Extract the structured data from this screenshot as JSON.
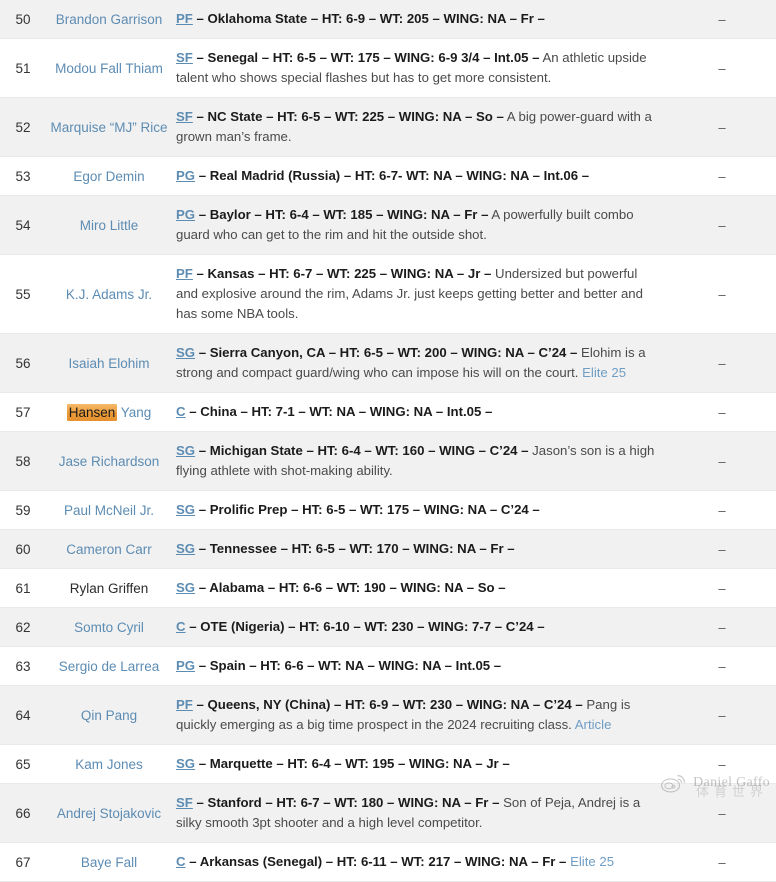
{
  "table": {
    "last_column_value": "–",
    "rows": [
      {
        "rank": "50",
        "name": "Brandon Garrison",
        "name_is_link": true,
        "highlight": "",
        "position": "PF",
        "headline": " – Oklahoma State – HT: 6-9 – WT: 205 – WING: NA – Fr –",
        "note": "",
        "link": "",
        "last": "–",
        "stripe": true
      },
      {
        "rank": "51",
        "name": "Modou Fall Thiam",
        "name_is_link": true,
        "highlight": "",
        "position": "SF",
        "headline": " – Senegal – HT: 6-5 – WT: 175 – WING: 6-9 3/4 – Int.05 –",
        "note": " An athletic upside talent who shows special flashes but has to get more consistent.",
        "link": "",
        "last": "–",
        "stripe": false
      },
      {
        "rank": "52",
        "name": "Marquise “MJ” Rice",
        "name_is_link": true,
        "highlight": "",
        "position": "SF",
        "headline": " – NC State – HT: 6-5 – WT: 225 – WING: NA – So –",
        "note": " A big power-guard with a grown man’s frame.",
        "link": "",
        "last": "–",
        "stripe": true
      },
      {
        "rank": "53",
        "name": "Egor Demin",
        "name_is_link": true,
        "highlight": "",
        "position": "PG",
        "headline": " – Real Madrid (Russia) – HT: 6-7- WT: NA – WING: NA – Int.06 –",
        "note": "",
        "link": "",
        "last": "–",
        "stripe": false
      },
      {
        "rank": "54",
        "name": "Miro Little",
        "name_is_link": true,
        "highlight": "",
        "position": "PG",
        "headline": " – Baylor – HT: 6-4 – WT: 185 – WING: NA – Fr –",
        "note": " A powerfully built combo guard who can get to the rim and hit the outside shot.",
        "link": "",
        "last": "–",
        "stripe": true
      },
      {
        "rank": "55",
        "name": "K.J. Adams Jr.",
        "name_is_link": true,
        "highlight": "",
        "position": "PF",
        "headline": " – Kansas – HT: 6-7 – WT: 225 – WING: NA – Jr –",
        "note": " Undersized but powerful and explosive around the rim, Adams Jr. just keeps getting better and better and has some NBA tools.",
        "link": "",
        "last": "–",
        "stripe": false
      },
      {
        "rank": "56",
        "name": "Isaiah Elohim",
        "name_is_link": true,
        "highlight": "",
        "position": "SG",
        "headline": " – Sierra Canyon, CA – HT: 6-5 – WT: 200 – WING: NA – C’24 –",
        "note": " Elohim is a strong and compact guard/wing who can impose his will on the court.",
        "link": "Elite 25",
        "last": "–",
        "stripe": true
      },
      {
        "rank": "57",
        "name": "Hansen Yang",
        "name_is_link": true,
        "highlight": "Hansen",
        "position": "C",
        "headline": " – China – HT: 7-1 – WT: NA – WING: NA – Int.05 –",
        "note": "",
        "link": "",
        "last": "–",
        "stripe": false
      },
      {
        "rank": "58",
        "name": "Jase Richardson",
        "name_is_link": true,
        "highlight": "",
        "position": "SG",
        "headline": " – Michigan State – HT: 6-4 – WT: 160 – WING – C’24 –",
        "note": " Jason’s son is a high flying athlete with shot-making ability.",
        "link": "",
        "last": "–",
        "stripe": true
      },
      {
        "rank": "59",
        "name": "Paul McNeil Jr.",
        "name_is_link": true,
        "highlight": "",
        "position": "SG",
        "headline": " – Prolific Prep – HT: 6-5 – WT: 175 – WING: NA – C’24 –",
        "note": "",
        "link": "",
        "last": "–",
        "stripe": false
      },
      {
        "rank": "60",
        "name": "Cameron Carr",
        "name_is_link": true,
        "highlight": "",
        "position": "SG",
        "headline": " – Tennessee – HT: 6-5 – WT: 170 – WING: NA – Fr –",
        "note": "",
        "link": "",
        "last": "–",
        "stripe": true
      },
      {
        "rank": "61",
        "name": "Rylan Griffen",
        "name_is_link": false,
        "highlight": "",
        "position": "SG",
        "headline": " – Alabama – HT: 6-6 – WT: 190 – WING: NA – So –",
        "note": "",
        "link": "",
        "last": "–",
        "stripe": false
      },
      {
        "rank": "62",
        "name": "Somto Cyril",
        "name_is_link": true,
        "highlight": "",
        "position": "C",
        "headline": " – OTE (Nigeria) – HT: 6-10 – WT: 230 – WING: 7-7 – C’24 –",
        "note": "",
        "link": "",
        "last": "–",
        "stripe": true
      },
      {
        "rank": "63",
        "name": "Sergio de Larrea",
        "name_is_link": true,
        "highlight": "",
        "position": "PG",
        "headline": " – Spain – HT: 6-6 – WT: NA – WING: NA – Int.05 –",
        "note": "",
        "link": "",
        "last": "–",
        "stripe": false
      },
      {
        "rank": "64",
        "name": "Qin Pang",
        "name_is_link": true,
        "highlight": "",
        "position": "PF",
        "headline": " – Queens, NY (China) – HT: 6-9 – WT: 230 – WING: NA – C’24 –",
        "note": " Pang is quickly emerging as a big time prospect in the 2024 recruiting class.",
        "link": "Article",
        "last": "–",
        "stripe": true
      },
      {
        "rank": "65",
        "name": "Kam Jones",
        "name_is_link": true,
        "highlight": "",
        "position": "SG",
        "headline": " – Marquette – HT: 6-4 – WT: 195 – WING: NA – Jr –",
        "note": "",
        "link": "",
        "last": "–",
        "stripe": false
      },
      {
        "rank": "66",
        "name": "Andrej Stojakovic",
        "name_is_link": true,
        "highlight": "",
        "position": "SF",
        "headline": " – Stanford – HT: 6-7 – WT: 180 – WING: NA – Fr –",
        "note": " Son of Peja, Andrej is a silky smooth 3pt shooter and a high level competitor.",
        "link": "",
        "last": "–",
        "stripe": true
      },
      {
        "rank": "67",
        "name": "Baye Fall",
        "name_is_link": true,
        "highlight": "",
        "position": "C",
        "headline": " – Arkansas (Senegal) – HT: 6-11 – WT: 217 – WING: NA – Fr –",
        "note": "",
        "link": "Elite 25",
        "last": "–",
        "stripe": false
      }
    ]
  },
  "watermark": {
    "text": "Daniel Gaffo",
    "cjk": "体育世界",
    "logo_name": "weibo-logo-icon"
  },
  "colors": {
    "link_blue": "#5d8cb3",
    "stripe_bg": "#f1f1f1",
    "highlight_orange": "#eb9a36",
    "text": "#3a3a3a"
  }
}
